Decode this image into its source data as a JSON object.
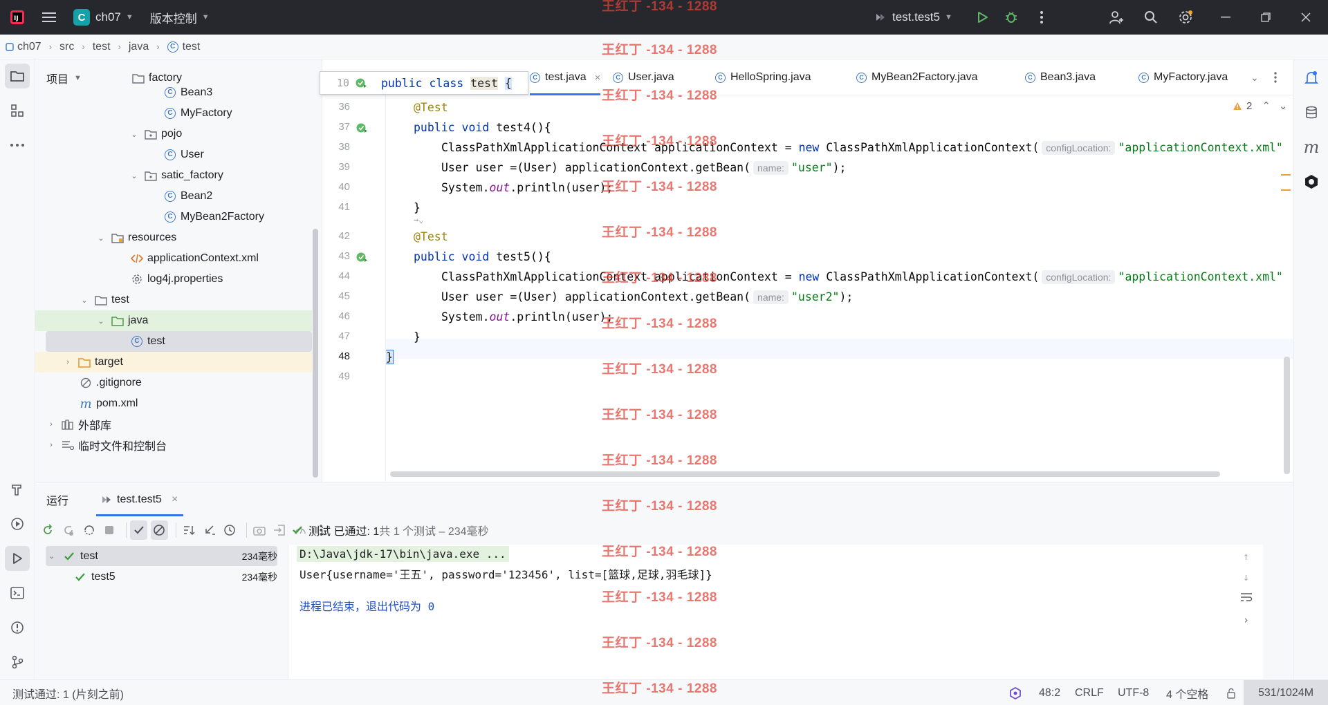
{
  "titlebar": {
    "project_initial": "C",
    "project_name": "ch07",
    "vcs_label": "版本控制",
    "run_config": "test.test5"
  },
  "breadcrumb": [
    "ch07",
    "src",
    "test",
    "java",
    "test"
  ],
  "project_panel": {
    "title": "项目",
    "items": [
      {
        "label": "factory",
        "kind": "package",
        "depth": 5
      },
      {
        "label": "Bean3",
        "kind": "class",
        "depth": 6
      },
      {
        "label": "MyFactory",
        "kind": "class",
        "depth": 6
      },
      {
        "label": "pojo",
        "kind": "package",
        "depth": 5
      },
      {
        "label": "User",
        "kind": "class",
        "depth": 6
      },
      {
        "label": "satic_factory",
        "kind": "package",
        "depth": 5
      },
      {
        "label": "Bean2",
        "kind": "class",
        "depth": 6
      },
      {
        "label": "MyBean2Factory",
        "kind": "class",
        "depth": 6
      },
      {
        "label": "resources",
        "kind": "resources-folder",
        "depth": 3
      },
      {
        "label": "applicationContext.xml",
        "kind": "xml",
        "depth": 4
      },
      {
        "label": "log4j.properties",
        "kind": "properties",
        "depth": 4
      },
      {
        "label": "test",
        "kind": "folder",
        "depth": 2
      },
      {
        "label": "java",
        "kind": "test-source-folder",
        "depth": 3
      },
      {
        "label": "test",
        "kind": "class",
        "depth": 4
      },
      {
        "label": "target",
        "kind": "excluded-folder",
        "depth": 1
      },
      {
        "label": ".gitignore",
        "kind": "ignore",
        "depth": 2
      },
      {
        "label": "pom.xml",
        "kind": "maven",
        "depth": 2
      },
      {
        "label": "外部库",
        "kind": "library",
        "depth": 0
      },
      {
        "label": "临时文件和控制台",
        "kind": "scratches",
        "depth": 0
      }
    ]
  },
  "editor": {
    "tabs": [
      "test.java",
      "User.java",
      "HelloSpring.java",
      "MyBean2Factory.java",
      "Bean3.java",
      "MyFactory.java"
    ],
    "active_tab": "test.java",
    "warning_count": "2",
    "sticky": {
      "line": "10",
      "text_kw": "public class ",
      "text_name": "test",
      "brace": "{"
    },
    "lines": {
      "l36": {
        "num": "36",
        "ann": "@Test"
      },
      "l37": {
        "num": "37",
        "kw": "public void ",
        "rest": "test4(){"
      },
      "l38": {
        "num": "38",
        "pre": "ClassPathXmlApplicationContext applicationContext = ",
        "kw": "new",
        "post": " ClassPathXmlApplicationContext(",
        "hint": "configLocation:",
        "str": "\"applicationContext.xml\""
      },
      "l39": {
        "num": "39",
        "pre": "User user =(User) applicationContext.getBean(",
        "hint": "name:",
        "str": "\"user\"",
        "post": ");"
      },
      "l40": {
        "num": "40",
        "pre": "System.",
        "ital": "out",
        "post": ".println(user);"
      },
      "l41": {
        "num": "41",
        "text": "}"
      },
      "l42": {
        "num": "42",
        "ann": "@Test"
      },
      "l43": {
        "num": "43",
        "kw": "public void ",
        "rest": "test5(){"
      },
      "l44": {
        "num": "44",
        "pre": "ClassPathXmlApplicationContext applicationContext = ",
        "kw": "new",
        "post": " ClassPathXmlApplicationContext(",
        "hint": "configLocation:",
        "str": "\"applicationContext.xml\""
      },
      "l45": {
        "num": "45",
        "pre": "User user =(User) applicationContext.getBean(",
        "hint": "name:",
        "str": "\"user2\"",
        "post": ");"
      },
      "l46": {
        "num": "46",
        "pre": "System.",
        "ital": "out",
        "post": ".println(user);"
      },
      "l47": {
        "num": "47",
        "text": "}"
      },
      "l48": {
        "num": "48",
        "text": "}"
      },
      "l49": {
        "num": "49"
      }
    }
  },
  "run_panel": {
    "title": "运行",
    "tab": "test.test5",
    "tree": [
      {
        "label": "test",
        "time": "234毫秒"
      },
      {
        "label": "test5",
        "time": "234毫秒"
      }
    ],
    "summary_prefix": "测试 已通过: 1",
    "summary_suffix": "共 1 个测试 – 234毫秒",
    "console": {
      "cmd": "D:\\Java\\jdk-17\\bin\\java.exe ...",
      "output": "User{username='王五', password='123456', list=[篮球,足球,羽毛球]}",
      "exit": "进程已结束，退出代码为 0"
    }
  },
  "statusbar": {
    "left": "测试通过: 1 (片刻之前)",
    "position": "48:2",
    "line_sep": "CRLF",
    "encoding": "UTF-8",
    "indent": "4 个空格",
    "memory": "531/1024M"
  },
  "watermark": "王红丁 -134 - 1288",
  "colors": {
    "accent": "#3574f0",
    "keyword": "#0033b3",
    "annotation": "#9e880d",
    "string": "#067d17",
    "success": "#3a9d3a",
    "watermark": "#e24238"
  }
}
